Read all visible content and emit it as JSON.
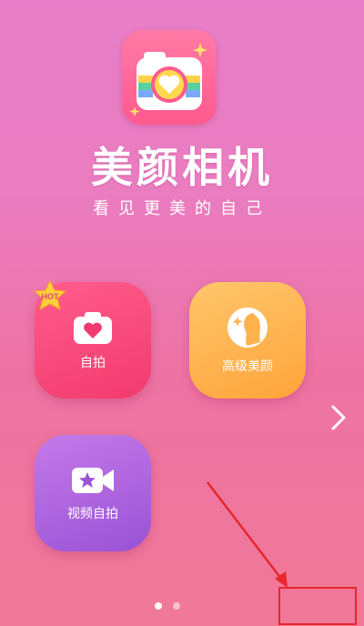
{
  "app": {
    "title": "美颜相机",
    "subtitle": "看见更美的自己"
  },
  "tiles": [
    {
      "id": "selfie",
      "label": "自拍",
      "icon": "camera-heart-icon",
      "badge": "HOT"
    },
    {
      "id": "beauty",
      "label": "高级美颜",
      "icon": "face-sparkle-icon"
    },
    {
      "id": "video",
      "label": "视频自拍",
      "icon": "video-star-icon"
    }
  ],
  "pager": {
    "pages": 2,
    "current": 1
  },
  "colors": {
    "selfie": "#f2456f",
    "beauty": "#ffb24c",
    "video": "#a85fdc",
    "annotation": "#e8262b"
  }
}
